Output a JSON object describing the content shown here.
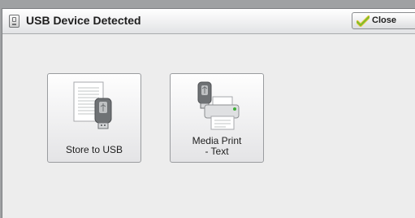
{
  "dialog": {
    "title": "USB Device Detected",
    "title_icon": "usb-drive-icon",
    "close_label": "Close",
    "close_icon": "checkmark-icon"
  },
  "options": [
    {
      "label": "Store to USB",
      "icon": "document-usb-icon"
    },
    {
      "label_line1": "Media Print",
      "label_line2": "- Text",
      "icon": "usb-printer-icon"
    }
  ],
  "colors": {
    "background": "#ededed",
    "titlebar": "#e2e3e5",
    "check_green": "#7cbd2a",
    "check_yellow": "#e6c43a"
  }
}
